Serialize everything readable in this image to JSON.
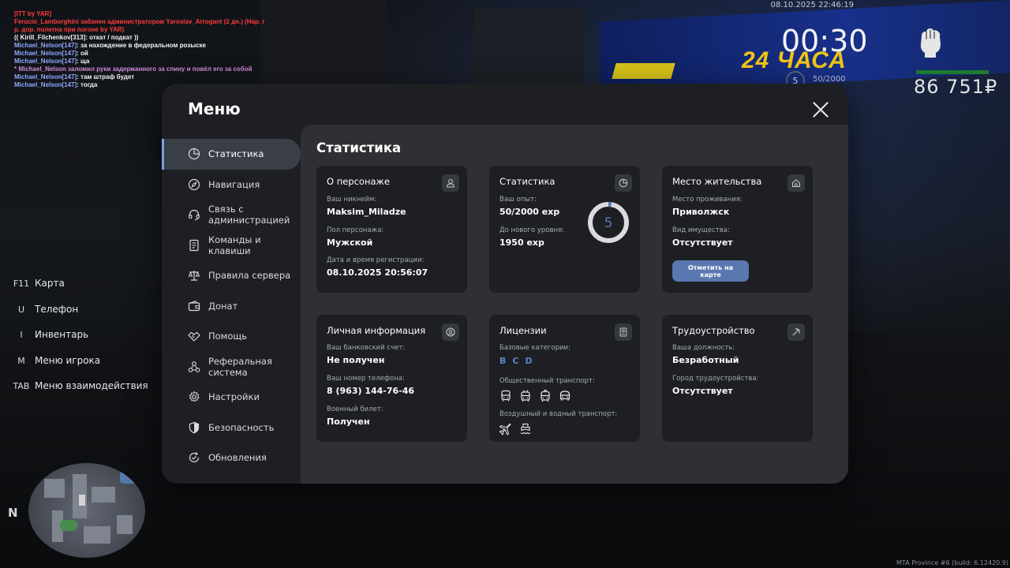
{
  "chat": [
    {
      "text": "[ITT by YAR]",
      "color": "red"
    },
    {
      "text": "Ferucio_Lamborghini забанен администратором Yaroslav_Arrogant (2 дн.) (Нар. г",
      "color": "red"
    },
    {
      "text": "р. дор. полетна при погоне by YAR)",
      "color": "red"
    },
    {
      "text": "(( Kirill_Filchenkov[313]: откат / подкат ))",
      "color": "white"
    },
    {
      "name": "Michael_Nelson[147]",
      "text": ": за нахождение в федеральном розыске",
      "color": "blue"
    },
    {
      "name": "Michael_Nelson[147]",
      "text": ": ой",
      "color": "blue"
    },
    {
      "name": "Michael_Nelson[147]",
      "text": ": ща",
      "color": "blue"
    },
    {
      "text": "* Michael_Nelson заломил руки задержанного за спину и повёл его за собой",
      "color": "pink"
    },
    {
      "name": "Michael_Nelson[147]",
      "text": ": там штраф будет",
      "color": "blue"
    },
    {
      "name": "Michael_Nelson[147]",
      "text": ": тогда",
      "color": "blue"
    }
  ],
  "hud": {
    "datetime": "08.10.2025 22:46:19",
    "timer": "00:30",
    "level": "5",
    "exp": "50/2000",
    "money": "86 751₽",
    "health_color": "#1e7a2c"
  },
  "billboard": {
    "text": "24 ЧАСА"
  },
  "hotkeys": [
    {
      "key": "F11",
      "label": "Карта"
    },
    {
      "key": "U",
      "label": "Телефон"
    },
    {
      "key": "I",
      "label": "Инвентарь"
    },
    {
      "key": "M",
      "label": "Меню игрока"
    },
    {
      "key": "TAB",
      "label": "Меню взаимодействия"
    }
  ],
  "minimap": {
    "north": "N"
  },
  "build_info": "MTA Province #6 (build: 6.12420.9)",
  "menu": {
    "title": "Меню",
    "nav": [
      {
        "label": "Статистика",
        "icon": "pie-chart-icon",
        "active": true
      },
      {
        "label": "Навигация",
        "icon": "compass-icon"
      },
      {
        "label": "Связь с администрацией",
        "icon": "headset-icon"
      },
      {
        "label": "Команды и клавиши",
        "icon": "document-icon"
      },
      {
        "label": "Правила сервера",
        "icon": "scales-icon"
      },
      {
        "label": "Донат",
        "icon": "wallet-icon"
      },
      {
        "label": "Помощь",
        "icon": "handshake-icon"
      },
      {
        "label": "Реферальная система",
        "icon": "network-icon"
      },
      {
        "label": "Настройки",
        "icon": "gear-icon"
      },
      {
        "label": "Безопасность",
        "icon": "shield-icon"
      },
      {
        "label": "Обновления",
        "icon": "refresh-check-icon"
      }
    ],
    "content_title": "Статистика",
    "accent": "#5a78b0",
    "cards": {
      "character": {
        "title": "О персонаже",
        "nick_label": "Ваш никнейм:",
        "nick": "Maksim_Miladze",
        "gender_label": "Пол персонажа:",
        "gender": "Мужской",
        "reg_label": "Дата и время регистрации:",
        "reg": "08.10.2025 20:56:07"
      },
      "stats": {
        "title": "Статистика",
        "exp_label": "Ваш опыт:",
        "exp": "50/2000 exp",
        "next_label": "До нового уровня:",
        "next": "1950 exp",
        "level": "5",
        "progress": 0.025
      },
      "residence": {
        "title": "Место жительства",
        "place_label": "Место проживания:",
        "place": "Приволжск",
        "property_label": "Вид имущества:",
        "property": "Отсутствует",
        "button": "Отметить на карте"
      },
      "personal": {
        "title": "Личная информация",
        "bank_label": "Ваш банковский счет:",
        "bank": "Не получен",
        "phone_label": "Ваш номер телефона:",
        "phone": "8 (963) 144-76-46",
        "military_label": "Военный билет:",
        "military": "Получен"
      },
      "licenses": {
        "title": "Лицензии",
        "basic_label": "Базовые категории:",
        "categories": [
          "B",
          "C",
          "D"
        ],
        "public_label": "Общественный транспорт:",
        "public": [
          "bus-icon",
          "trolleybus-icon",
          "tram-icon",
          "minibus-icon"
        ],
        "air_label": "Воздушный и водный транспорт:",
        "air": [
          "airplane-icon",
          "boat-icon"
        ]
      },
      "employment": {
        "title": "Трудоустройство",
        "position_label": "Ваша должность:",
        "position": "Безработный",
        "city_label": "Город трудоустройства:",
        "city": "Отсутствует"
      }
    }
  }
}
